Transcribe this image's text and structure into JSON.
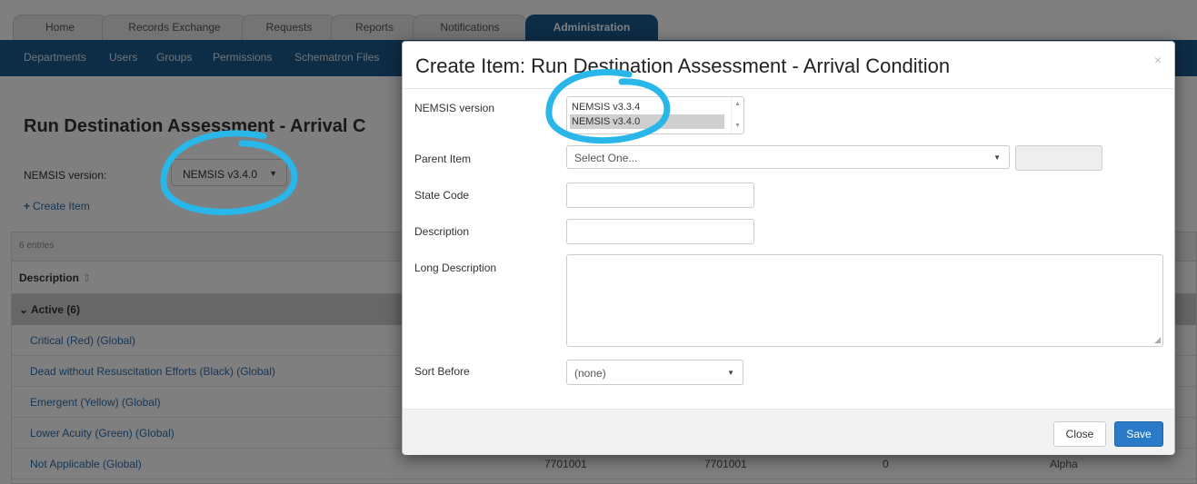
{
  "tabs": [
    {
      "label": "Home"
    },
    {
      "label": "Records Exchange"
    },
    {
      "label": "Requests"
    },
    {
      "label": "Reports"
    },
    {
      "label": "Notifications"
    },
    {
      "label": "Administration"
    }
  ],
  "subnav": [
    {
      "label": "Departments"
    },
    {
      "label": "Users"
    },
    {
      "label": "Groups"
    },
    {
      "label": "Permissions"
    },
    {
      "label": "Schematron Files"
    }
  ],
  "page": {
    "title": "Run Destination Assessment - Arrival C",
    "nemsis_label": "NEMSIS version:",
    "nemsis_value": "NEMSIS v3.4.0",
    "create_label": "Create Item"
  },
  "grid": {
    "entries": "6 entries",
    "column_description": "Description",
    "group_label": "Active (6)",
    "rows": [
      {
        "description": "Critical (Red) (Global)"
      },
      {
        "description": "Dead without Resuscitation Efforts (Black) (Global)"
      },
      {
        "description": "Emergent (Yellow) (Global)"
      },
      {
        "description": "Lower Acuity (Green) (Global)"
      },
      {
        "description": "Not Applicable (Global)",
        "code": "7701001",
        "code2": "7701001",
        "num": "0",
        "sort": "Alpha"
      }
    ]
  },
  "modal": {
    "title": "Create Item: Run Destination Assessment - Arrival Condition",
    "close_x": "×",
    "nemsis_label": "NEMSIS version",
    "nemsis_options": [
      "NEMSIS v3.3.4",
      "NEMSIS v3.4.0"
    ],
    "nemsis_selected": "NEMSIS v3.4.0",
    "parent_label": "Parent Item",
    "parent_placeholder": "Select One...",
    "state_code_label": "State Code",
    "state_code_value": "",
    "description_label": "Description",
    "description_value": "",
    "long_description_label": "Long Description",
    "long_description_value": "",
    "sort_before_label": "Sort Before",
    "sort_before_value": "(none)",
    "close_button": "Close",
    "save_button": "Save"
  },
  "colors": {
    "nav_blue": "#1a5a8e",
    "link_blue": "#2a6fb0",
    "save_blue": "#2a7ac8",
    "annotation_cyan": "#29b6e8"
  }
}
